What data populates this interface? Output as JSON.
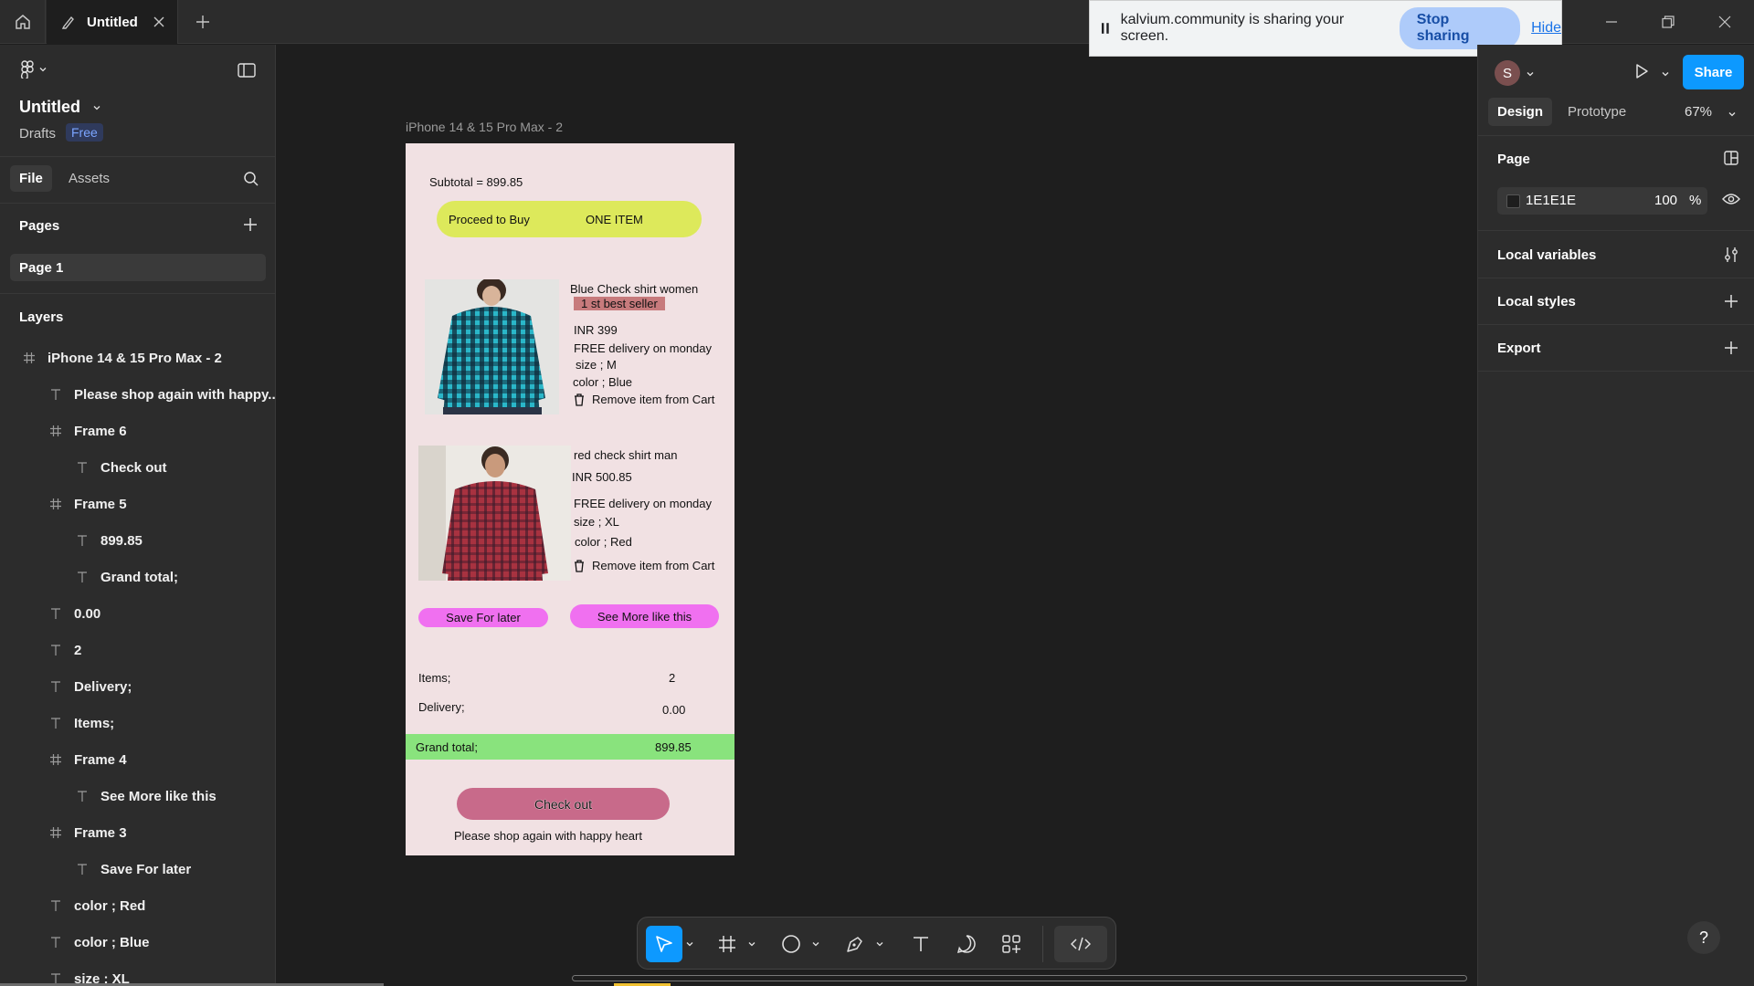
{
  "tab": {
    "title": "Untitled"
  },
  "screen_share": {
    "message": "kalvium.community is sharing your screen.",
    "stop_label": "Stop sharing",
    "hide_label": "Hide"
  },
  "left_panel": {
    "file_name": "Untitled",
    "location": "Drafts",
    "plan_badge": "Free",
    "tabs": {
      "file": "File",
      "assets": "Assets"
    },
    "pages_title": "Pages",
    "pages": [
      "Page 1"
    ],
    "layers_title": "Layers",
    "layers": [
      {
        "icon": "frame",
        "label": "iPhone 14 & 15 Pro Max - 2",
        "indent": 0
      },
      {
        "icon": "text",
        "label": "Please shop again with happy...",
        "indent": 1
      },
      {
        "icon": "frame",
        "label": "Frame 6",
        "indent": 1
      },
      {
        "icon": "text",
        "label": "Check out",
        "indent": 2
      },
      {
        "icon": "frame",
        "label": "Frame 5",
        "indent": 1
      },
      {
        "icon": "text",
        "label": "899.85",
        "indent": 2
      },
      {
        "icon": "text",
        "label": "Grand total;",
        "indent": 2
      },
      {
        "icon": "text",
        "label": "0.00",
        "indent": 1
      },
      {
        "icon": "text",
        "label": "2",
        "indent": 1
      },
      {
        "icon": "text",
        "label": "Delivery;",
        "indent": 1
      },
      {
        "icon": "text",
        "label": "Items;",
        "indent": 1
      },
      {
        "icon": "frame",
        "label": "Frame 4",
        "indent": 1
      },
      {
        "icon": "text",
        "label": "See More like this",
        "indent": 2
      },
      {
        "icon": "frame",
        "label": "Frame 3",
        "indent": 1
      },
      {
        "icon": "text",
        "label": "Save For later",
        "indent": 2
      },
      {
        "icon": "text",
        "label": "color ; Red",
        "indent": 1
      },
      {
        "icon": "text",
        "label": "color ; Blue",
        "indent": 1
      },
      {
        "icon": "text",
        "label": "size ; XL",
        "indent": 1
      }
    ]
  },
  "canvas": {
    "frame_label": "iPhone 14 & 15 Pro Max - 2",
    "subtotal": "Subtotal = 899.85",
    "proceed_label": "Proceed to Buy",
    "one_item_label": "ONE ITEM",
    "product1": {
      "name": "Blue Check shirt women",
      "badge": "1 st best seller",
      "price": "INR 399",
      "delivery": "FREE delivery on monday",
      "size": "size ; M",
      "color": "color ; Blue",
      "remove": "Remove item from Cart"
    },
    "product2": {
      "name": "red check shirt man",
      "price": "INR 500.85",
      "delivery": "FREE delivery on monday",
      "size": "size ; XL",
      "color": "color ; Red",
      "remove": "Remove item from Cart"
    },
    "save_later": "Save For later",
    "see_more": "See More like this",
    "items_label": "Items;",
    "items_value": "2",
    "delivery_label": "Delivery;",
    "delivery_value": "0.00",
    "grand_label": "Grand total;",
    "grand_value": "899.85",
    "checkout": "Check out",
    "footer": "Please  shop again with happy heart"
  },
  "right_panel": {
    "avatar_initial": "S",
    "share_label": "Share",
    "tabs": {
      "design": "Design",
      "prototype": "Prototype"
    },
    "zoom": "67%",
    "page_section": "Page",
    "page_color": "1E1E1E",
    "page_opacity": "100",
    "percent_sign": "%",
    "local_variables": "Local variables",
    "local_styles": "Local styles",
    "export": "Export",
    "help": "?"
  },
  "colors": {
    "canvas_bg": "#1e1e1e",
    "panel_bg": "#2c2c2c",
    "accent": "#0d99ff",
    "frame_bg": "#f1e1e3",
    "proceed_pill": "#dde95b",
    "pink_pill": "#f070f0",
    "grand_bar": "#89e37d",
    "checkout_btn": "#c86a8a"
  }
}
